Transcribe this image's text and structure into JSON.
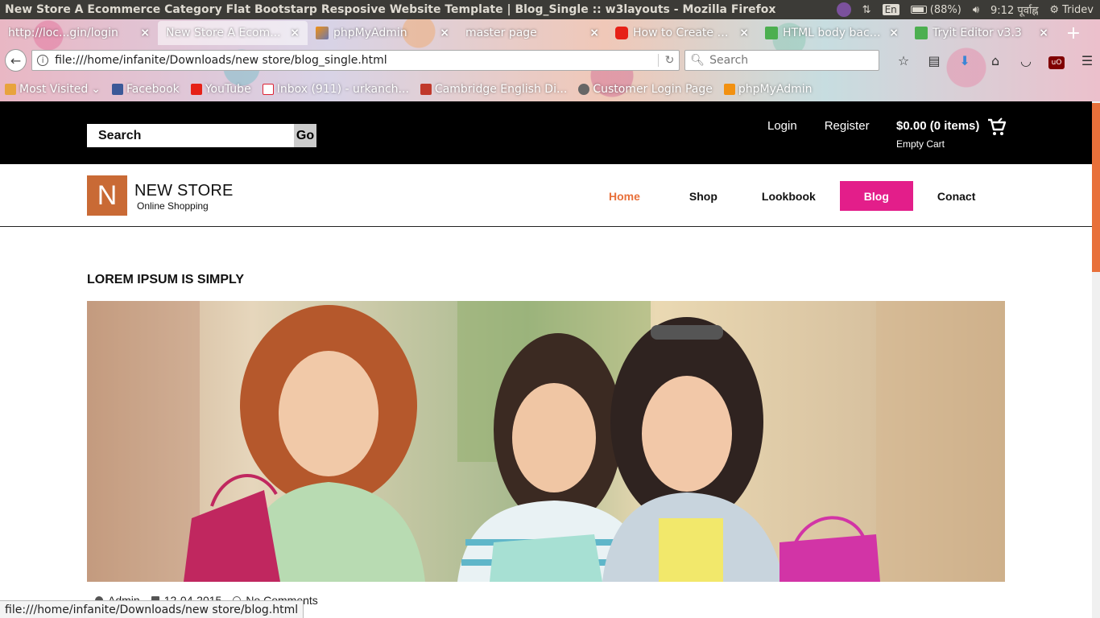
{
  "os": {
    "window_title": "New Store A Ecommerce Category Flat Bootstarp Resposive Website Template | Blog_Single :: w3layouts - Mozilla Firefox",
    "lang": "En",
    "battery": "(88%)",
    "time": "9:12 पूर्वाह्न",
    "user": "Tridev"
  },
  "browser": {
    "tabs": [
      {
        "label": "http://loc...gin/login",
        "icon": "page-icon"
      },
      {
        "label": "New Store A Ecom...",
        "icon": "page-icon",
        "active": true
      },
      {
        "label": "phpMyAdmin",
        "icon": "phpmyadmin-icon"
      },
      {
        "label": "master page",
        "icon": "page-icon"
      },
      {
        "label": "How to Create A...",
        "icon": "youtube-icon"
      },
      {
        "label": "HTML body back...",
        "icon": "w3schools-icon"
      },
      {
        "label": "Tryit Editor v3.3",
        "icon": "w3schools-icon"
      }
    ],
    "url": "file:///home/infanite/Downloads/new store/blog_single.html",
    "search_placeholder": "Search",
    "bookmarks": [
      {
        "label": "Most Visited",
        "icon": "folder-icon"
      },
      {
        "label": "Facebook",
        "icon": "facebook-icon"
      },
      {
        "label": "YouTube",
        "icon": "youtube-icon"
      },
      {
        "label": "Inbox (911) - urkanch...",
        "icon": "gmail-icon"
      },
      {
        "label": "Cambridge English Di...",
        "icon": "cambridge-icon"
      },
      {
        "label": "Customer Login Page",
        "icon": "globe-icon"
      },
      {
        "label": "phpMyAdmin",
        "icon": "phpmyadmin-icon"
      }
    ],
    "status_url": "file:///home/infanite/Downloads/new store/blog.html"
  },
  "site": {
    "search_placeholder": "Search",
    "go_label": "Go",
    "login": "Login",
    "register": "Register",
    "cart_total": "$0.00 (0 items)",
    "cart_empty": "Empty Cart",
    "logo_letter": "N",
    "logo_name": "NEW STORE",
    "logo_tagline": "Online Shopping",
    "menu": [
      {
        "label": "Home"
      },
      {
        "label": "Shop"
      },
      {
        "label": "Lookbook"
      },
      {
        "label": "Blog",
        "active": true
      },
      {
        "label": "Conact"
      }
    ],
    "accent_color": "#e8703a",
    "active_menu_color": "#e31e8a",
    "logo_color": "#c96a35"
  },
  "post": {
    "title": "LOREM IPSUM IS SIMPLY",
    "author": "Admin",
    "date": "12-04-2015",
    "comments": "No Comments"
  }
}
